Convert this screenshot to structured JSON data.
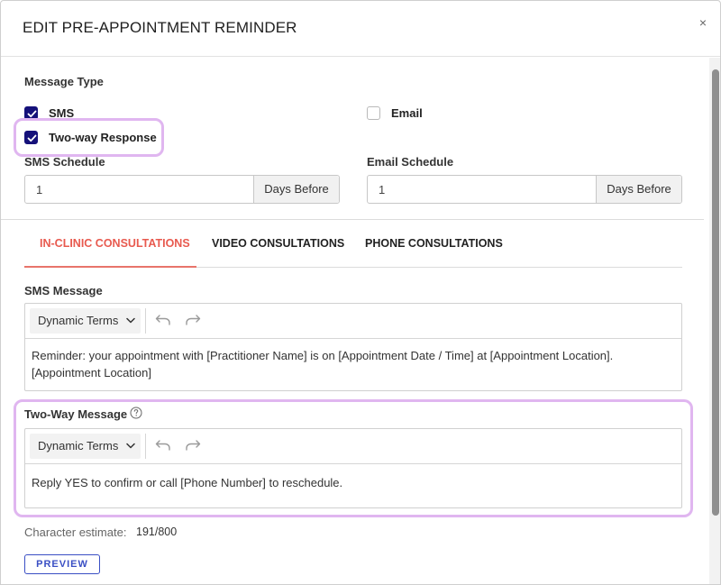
{
  "modal": {
    "title": "EDIT PRE-APPOINTMENT REMINDER",
    "close_glyph": "×"
  },
  "message_type": {
    "label": "Message Type",
    "sms": {
      "label": "SMS",
      "checked": true
    },
    "email": {
      "label": "Email",
      "checked": false
    },
    "two_way": {
      "label": "Two-way Response",
      "checked": true
    }
  },
  "sms_schedule": {
    "label": "SMS Schedule",
    "value": "1",
    "unit": "Days Before"
  },
  "email_schedule": {
    "label": "Email Schedule",
    "value": "1",
    "unit": "Days Before"
  },
  "tabs": [
    {
      "label": "IN-CLINIC CONSULTATIONS",
      "active": true
    },
    {
      "label": "VIDEO CONSULTATIONS",
      "active": false
    },
    {
      "label": "PHONE CONSULTATIONS",
      "active": false
    }
  ],
  "sms_message": {
    "label": "SMS Message",
    "dynamic_terms": "Dynamic Terms",
    "text_line1": "Reminder: your appointment with [Practitioner Name] is on [Appointment Date / Time] at [Appointment Location].",
    "text_line2": "[Appointment Location]"
  },
  "two_way_message": {
    "label": "Two-Way Message",
    "dynamic_terms": "Dynamic Terms",
    "text": "Reply YES to confirm or call [Phone Number] to reschedule."
  },
  "character_estimate": {
    "label": "Character estimate:",
    "value": "191/800"
  },
  "preview_button": "PREVIEW",
  "icons": {
    "close": "close-icon",
    "check": "check-icon",
    "chevron": "chevron-down-icon",
    "undo": "undo-icon",
    "redo": "redo-icon",
    "help": "help-circle-icon"
  },
  "colors": {
    "accent_tab": "#e85a4f",
    "checkbox": "#15117a",
    "highlight": "#e0b6f0",
    "preview": "#3a4fc4"
  }
}
